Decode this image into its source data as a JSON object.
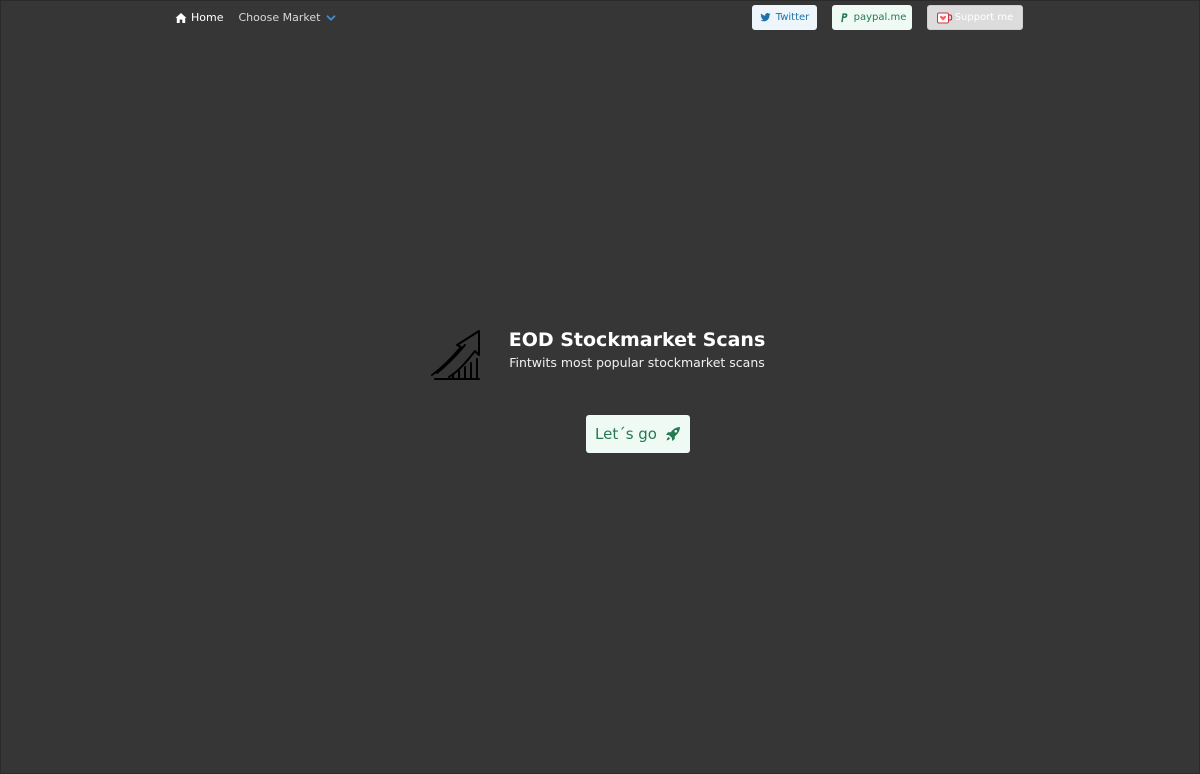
{
  "nav": {
    "home_label": "Home",
    "home_icon": "home-icon",
    "market_label": "Choose Market",
    "market_icon": "chevron-down-icon"
  },
  "social": {
    "twitter_label": "Twitter",
    "twitter_icon": "twitter-icon",
    "paypal_label": "paypal.me",
    "paypal_icon": "paypal-icon",
    "support_label": "Support me",
    "support_icon": "ko-fi-cup-icon"
  },
  "hero": {
    "title": "EOD Stockmarket Scans",
    "subtitle": "Fintwits most popular stockmarket scans",
    "icon": "growth-chart-icon",
    "cta_label": "Let´s go",
    "cta_icon": "rocket-icon"
  },
  "colors": {
    "background": "#363636",
    "twitter_text": "#1d72aa",
    "success_text": "#257953",
    "chevron": "#3e8ed0"
  }
}
